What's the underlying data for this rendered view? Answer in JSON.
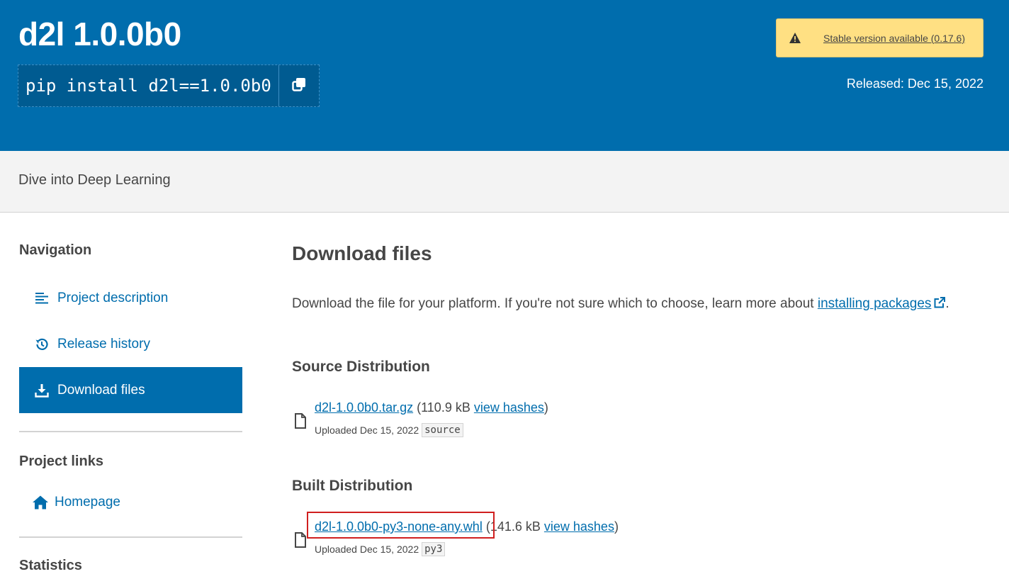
{
  "header": {
    "title": "d2l 1.0.0b0",
    "pip_command": "pip install d2l==1.0.0b0",
    "copy_icon": "copy-icon",
    "stable_banner": {
      "warning_icon": "warning-icon",
      "text": "Stable version available (0.17.6)"
    },
    "released": "Released: Dec 15, 2022"
  },
  "summary": "Dive into Deep Learning",
  "sidebar": {
    "navigation_heading": "Navigation",
    "items": [
      {
        "label": "Project description",
        "icon": "align-left-icon"
      },
      {
        "label": "Release history",
        "icon": "history-icon"
      },
      {
        "label": "Download files",
        "icon": "download-icon",
        "active": true
      }
    ],
    "links_heading": "Project links",
    "links": [
      {
        "label": "Homepage",
        "icon": "home-icon"
      }
    ],
    "statistics_heading": "Statistics"
  },
  "main": {
    "title": "Download files",
    "intro_text": "Download the file for your platform. If you're not sure which to choose, learn more about ",
    "intro_link": "installing packages",
    "intro_end": ".",
    "source_heading": "Source Distribution",
    "built_heading": "Built Distribution",
    "files": [
      {
        "name": "d2l-1.0.0b0.tar.gz",
        "size": "(110.9 kB",
        "hashes_link": "view hashes",
        "close": ")",
        "uploaded": "Uploaded Dec 15, 2022",
        "tag": "source"
      },
      {
        "name": "d2l-1.0.0b0-py3-none-any.whl",
        "size": "(141.6 kB",
        "hashes_link": "view hashes",
        "close": ")",
        "uploaded": "Uploaded Dec 15, 2022",
        "tag": "py3"
      }
    ]
  },
  "colors": {
    "brand_blue": "#006dad",
    "banner_yellow": "#ffe083",
    "highlight_red": "#d01f1f"
  }
}
